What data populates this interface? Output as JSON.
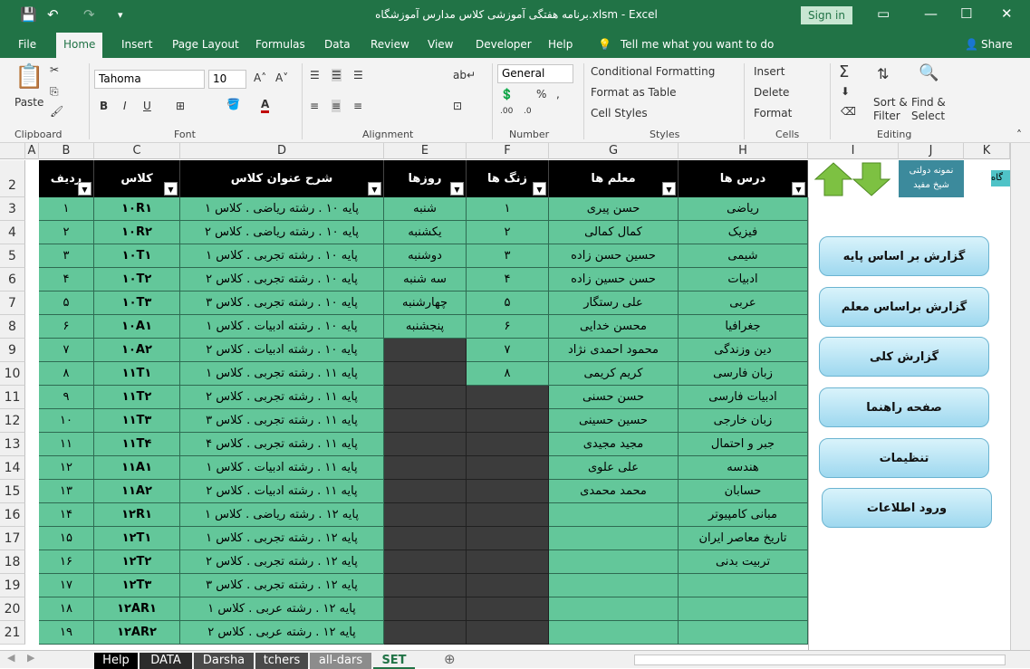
{
  "window": {
    "title": "برنامه هفتگی آموزشی کلاس مدارس آموزشگاه.xlsm  -  Excel",
    "signin_label": "Sign in",
    "share_label": "Share",
    "tell_me_label": "Tell me what you want to do"
  },
  "menu_tabs": [
    "File",
    "Home",
    "Insert",
    "Page Layout",
    "Formulas",
    "Data",
    "Review",
    "View",
    "Developer",
    "Help"
  ],
  "ribbon": {
    "paste_label": "Paste",
    "font_name": "Tahoma",
    "font_size": "10",
    "number_format": "General",
    "conditional_formatting": "Conditional Formatting",
    "format_as_table": "Format as Table",
    "cell_styles": "Cell Styles",
    "insert_label": "Insert",
    "delete_label": "Delete",
    "format_label": "Format",
    "sort_filter": "Sort & Filter",
    "find_select": "Find & Select",
    "groups": [
      "Clipboard",
      "Font",
      "Alignment",
      "Number",
      "Styles",
      "Cells",
      "Editing"
    ]
  },
  "columns": [
    "A",
    "B",
    "C",
    "D",
    "E",
    "F",
    "G",
    "H",
    "I",
    "J",
    "K"
  ],
  "rows": [
    "2",
    "3",
    "4",
    "5",
    "6",
    "7",
    "8",
    "9",
    "10",
    "11",
    "12",
    "13",
    "14",
    "15",
    "16",
    "17",
    "18",
    "19",
    "20",
    "21"
  ],
  "headers": {
    "radif": "ردیف",
    "kelas": "کلاس",
    "sharh": "شرح عنوان کلاس",
    "rooz": "روزها",
    "zang": "زنگ ها",
    "moalem": "معلم ها",
    "dars": "درس ها"
  },
  "table": {
    "radif": [
      "۱",
      "۲",
      "۳",
      "۴",
      "۵",
      "۶",
      "۷",
      "۸",
      "۹",
      "۱۰",
      "۱۱",
      "۱۲",
      "۱۳",
      "۱۴",
      "۱۵",
      "۱۶",
      "۱۷",
      "۱۸",
      "۱۹"
    ],
    "kelas": [
      "۱۰R۱",
      "۱۰R۲",
      "۱۰T۱",
      "۱۰T۲",
      "۱۰T۳",
      "۱۰A۱",
      "۱۰A۲",
      "۱۱T۱",
      "۱۱T۲",
      "۱۱T۳",
      "۱۱T۴",
      "۱۱A۱",
      "۱۱A۲",
      "۱۲R۱",
      "۱۲T۱",
      "۱۲T۲",
      "۱۲T۳",
      "۱۲AR۱",
      "۱۲AR۲"
    ],
    "sharh": [
      "پایه ۱۰ . رشته ریاضی . کلاس ۱",
      "پایه ۱۰ . رشته ریاضی . کلاس ۲",
      "پایه ۱۰ . رشته تجربی . کلاس ۱",
      "پایه ۱۰ . رشته تجربی . کلاس ۲",
      "پایه ۱۰ . رشته تجربی . کلاس ۳",
      "پایه ۱۰ . رشته ادبیات . کلاس ۱",
      "پایه ۱۰ . رشته ادبیات . کلاس ۲",
      "پایه ۱۱ . رشته تجربی . کلاس ۱",
      "پایه ۱۱ . رشته تجربی . کلاس ۲",
      "پایه ۱۱ . رشته تجربی . کلاس ۳",
      "پایه ۱۱ . رشته تجربی . کلاس ۴",
      "پایه ۱۱ . رشته ادبیات . کلاس ۱",
      "پایه ۱۱ . رشته ادبیات . کلاس ۲",
      "پایه ۱۲ . رشته ریاضی . کلاس ۱",
      "پایه ۱۲ . رشته تجربی . کلاس ۱",
      "پایه ۱۲ . رشته تجربی . کلاس ۲",
      "پایه ۱۲ . رشته تجربی . کلاس ۳",
      "پایه ۱۲ . رشته عربی . کلاس ۱",
      "پایه ۱۲ . رشته عربی . کلاس ۲"
    ],
    "rooz": [
      "شنبه",
      "یکشنبه",
      "دوشنبه",
      "سه شنبه",
      "چهارشنبه",
      "پنجشنبه"
    ],
    "zang": [
      "۱",
      "۲",
      "۳",
      "۴",
      "۵",
      "۶",
      "۷",
      "۸"
    ],
    "moalem": [
      "حسن پیری",
      "کمال کمالی",
      "حسین حسن زاده",
      "حسن حسین زاده",
      "علی رستگار",
      "محسن خدایی",
      "محمود احمدی نژاد",
      "کریم کریمی",
      "حسن حسنی",
      "حسین حسینی",
      "مجید مجیدی",
      "علی علوی",
      "محمد محمدی"
    ],
    "dars": [
      "ریاضی",
      "فیزیک",
      "شیمی",
      "ادبیات",
      "عربی",
      "جغرافیا",
      "دین وزندگی",
      "زبان فارسی",
      "ادبیات فارسی",
      "زبان خارجی",
      "جبر و احتمال",
      "هندسه",
      "حسابان",
      "مبانی کامپیوتر",
      "تاریخ معاصر ایران",
      "تربیت بدنی"
    ]
  },
  "logo_text": [
    "نمونه دولتی",
    "شیخ مفید"
  ],
  "k_cell_text": "گاه",
  "side_buttons": [
    "گزارش بر اساس پایه",
    "گزارش براساس معلم",
    "گزارش کلی",
    "صفحه راهنما",
    "تنظیمات",
    "ورود اطلاعات"
  ],
  "sheet_tabs": [
    {
      "label": "Help",
      "color": "#000000"
    },
    {
      "label": "DATA",
      "color": "#2b2b2b"
    },
    {
      "label": "Darsha",
      "color": "#4a4a4a"
    },
    {
      "label": "tchers",
      "color": "#4a4a4a"
    },
    {
      "label": "all-dars",
      "color": "#8c8c8c"
    },
    {
      "label": "SET",
      "color": "#ffffff"
    }
  ]
}
